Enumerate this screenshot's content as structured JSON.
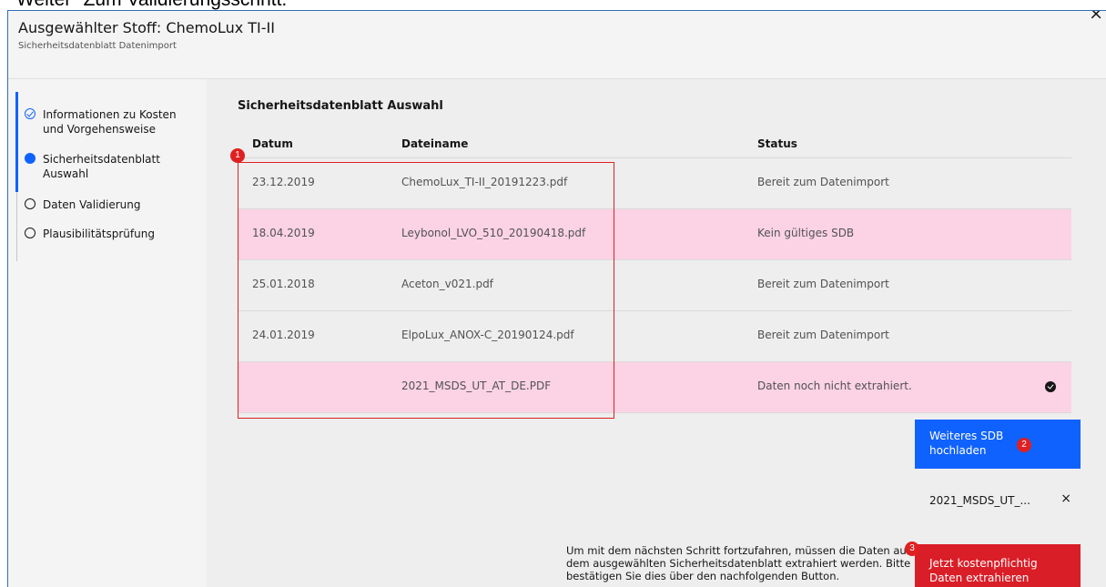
{
  "cutoff_text": "Weiter\" Zum Validierungsschritt.",
  "modal": {
    "title": "Ausgewählter Stoff: ChemoLux TI-II",
    "subtitle": "Sicherheitsdatenblatt Datenimport",
    "close_icon": "×"
  },
  "steps": [
    {
      "label": "Informationen zu Kosten und Vorgehensweise",
      "state": "done"
    },
    {
      "label": "Sicherheitsdatenblatt Auswahl",
      "state": "current"
    },
    {
      "label": "Daten Validierung",
      "state": "todo"
    },
    {
      "label": "Plausibilitätsprüfung",
      "state": "todo"
    }
  ],
  "section_title": "Sicherheitsdatenblatt Auswahl",
  "table": {
    "headers": [
      "Datum",
      "Dateiname",
      "Status"
    ],
    "rows": [
      {
        "date": "23.12.2019",
        "file": "ChemoLux_TI-II_20191223.pdf",
        "status": "Bereit zum Datenimport",
        "highlight": false
      },
      {
        "date": "18.04.2019",
        "file": "Leybonol_LVO_510_20190418.pdf",
        "status": "Kein gültiges SDB",
        "highlight": true
      },
      {
        "date": "25.01.2018",
        "file": "Aceton_v021.pdf",
        "status": "Bereit zum Datenimport",
        "highlight": false
      },
      {
        "date": "24.01.2019",
        "file": "ElpoLux_ANOX-C_20190124.pdf",
        "status": "Bereit zum Datenimport",
        "highlight": false
      },
      {
        "date": "",
        "file": "2021_MSDS_UT_AT_DE.PDF",
        "status": "Daten noch nicht extrahiert.",
        "highlight": true,
        "selected_icon": "checkmark-filled-icon"
      }
    ]
  },
  "markers": [
    "1",
    "2",
    "3"
  ],
  "upload_button": "Weiteres SDB hochladen",
  "uploaded_file": {
    "name": "2021_MSDS_UT_...",
    "remove_icon": "×"
  },
  "notice": "Um mit dem nächsten Schritt fortzufahren, müssen die Daten aus dem ausgewählten Sicherheitsdatenblatt extrahiert werden. Bitte bestätigen Sie dies über den nachfolgenden Button.",
  "extract_button": "Jetzt kostenpflichtig Daten extrahieren",
  "colors": {
    "accent": "#0f62fe",
    "danger": "#da1e28",
    "row_highlight": "#fbd3e4",
    "annotation": "#e02020"
  }
}
